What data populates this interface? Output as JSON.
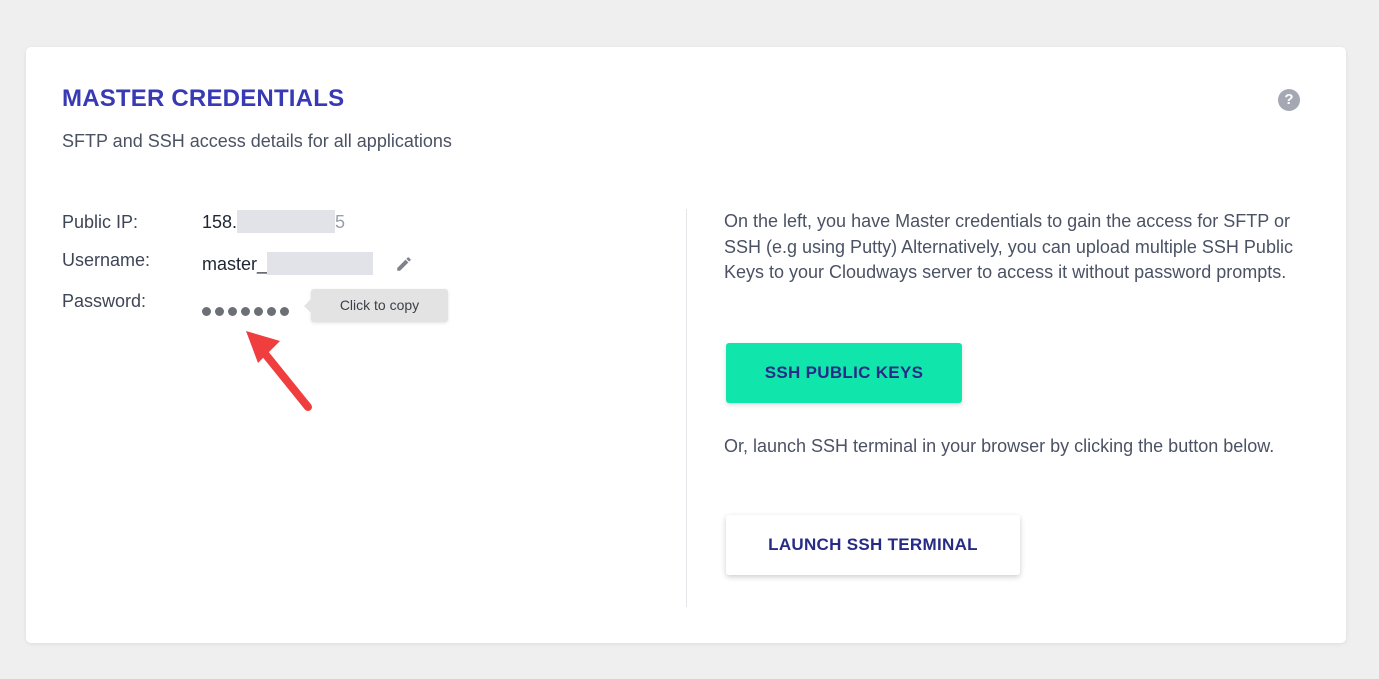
{
  "card": {
    "title": "MASTER CREDENTIALS",
    "subtitle": "SFTP and SSH access details for all applications",
    "help_icon": "question-circle-icon"
  },
  "credentials": {
    "public_ip_label": "Public IP:",
    "public_ip_prefix": "158.",
    "public_ip_suffix": "5",
    "username_label": "Username:",
    "username_prefix": "master_",
    "password_label": "Password:",
    "password_dot_count": 7,
    "tooltip": "Click to copy",
    "edit_icon": "pencil-icon"
  },
  "info": {
    "description": "On the left, you have Master credentials to gain the access for SFTP or SSH (e.g using Putty) Alternatively, you can upload multiple SSH Public Keys to your Cloudways server to access it without password prompts.",
    "ssh_keys_button": "SSH PUBLIC KEYS",
    "terminal_text": "Or, launch SSH terminal in your browser by clicking the button below.",
    "terminal_button": "LAUNCH SSH TERMINAL"
  },
  "colors": {
    "title": "#3739b5",
    "primary_button": "#10e6ac",
    "button_text": "#262b86",
    "annotation_arrow": "#f03e3e"
  }
}
